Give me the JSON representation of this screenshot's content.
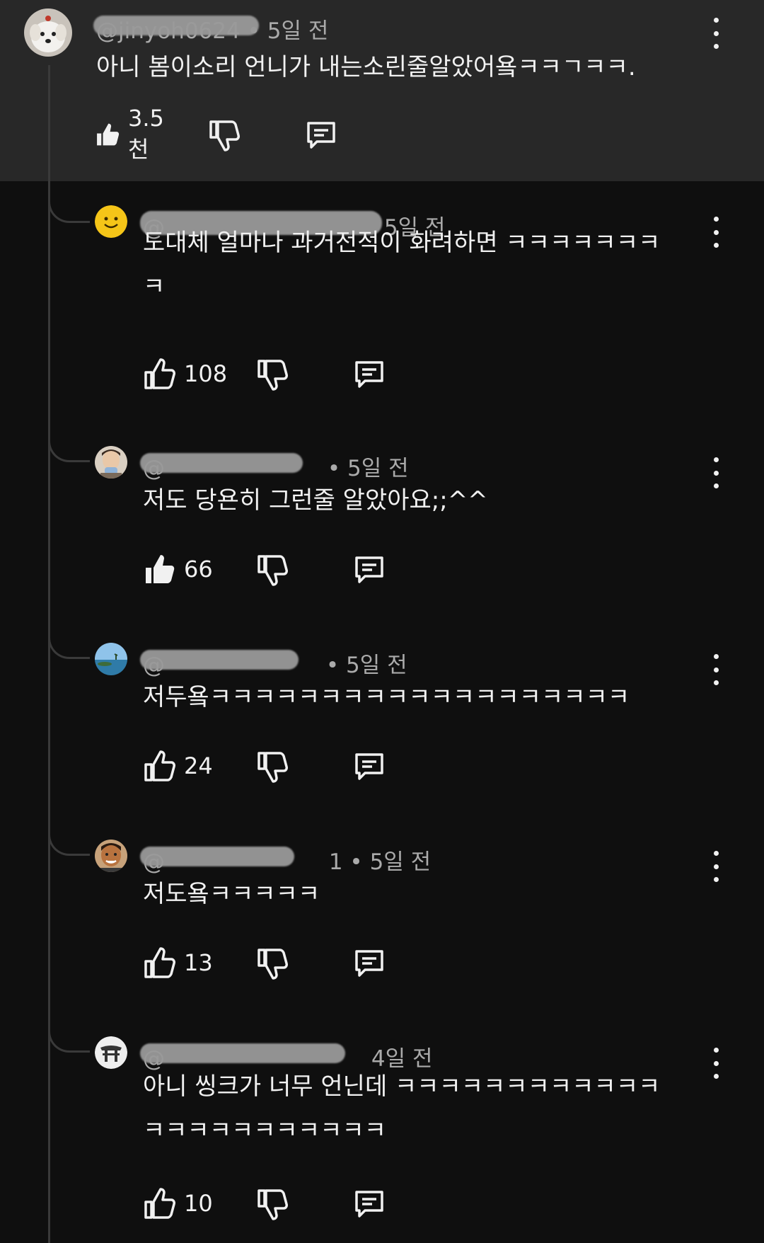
{
  "colors": {
    "background": "#0f0f0f",
    "highlight_band": "#282828",
    "text": "#f1f1f1",
    "meta": "#aaaaaa",
    "thread_line": "#3a3a3a"
  },
  "comments": [
    {
      "handle": "@jinyoh0624",
      "time": "• 5일 전",
      "text": [
        "아니 봄이소리 언니가 내는소린줄알았어욬ㅋㅋㄱㅋㅋ."
      ],
      "likes": "3.5천",
      "liked": true,
      "avatar": "dog-avatar-icon"
    },
    {
      "handle": "@",
      "time": "5일 전",
      "text": [
        "도대체 얼마나 과거전적이 화려하면 ㅋㅋㅋㅋㅋㅋㅋ",
        "ㅋ"
      ],
      "likes": "108",
      "liked": false,
      "avatar": "smiley-avatar-icon"
    },
    {
      "handle": "@",
      "time": "• 5일 전",
      "text": [
        "저도 당욘히 그런줄 알았아요;;^^"
      ],
      "likes": "66",
      "liked": true,
      "avatar": "person-avatar-icon"
    },
    {
      "handle": "@",
      "time": "• 5일 전",
      "text": [
        "저두욬ㅋㅋㅋㅋㅋㅋㅋㅋㅋㅋㅋㅋㅋㅋㅋㅋㅋㅋㅋ"
      ],
      "likes": "24",
      "liked": false,
      "avatar": "landscape-avatar-icon"
    },
    {
      "handle": "@",
      "time": "1 • 5일 전",
      "text": [
        "저도욬ㅋㅋㅋㅋㅋ"
      ],
      "likes": "13",
      "liked": false,
      "avatar": "man-avatar-icon"
    },
    {
      "handle": "@",
      "time": "4일 전",
      "text": [
        "아니 씽크가 너무 언닌데 ㅋㅋㅋㅋㅋㅋㅋㅋㅋㅋㅋㅋ",
        "ㅋㅋㅋㅋㅋㅋㅋㅋㅋㅋㅋ"
      ],
      "likes": "10",
      "liked": false,
      "avatar": "gate-avatar-icon"
    }
  ]
}
